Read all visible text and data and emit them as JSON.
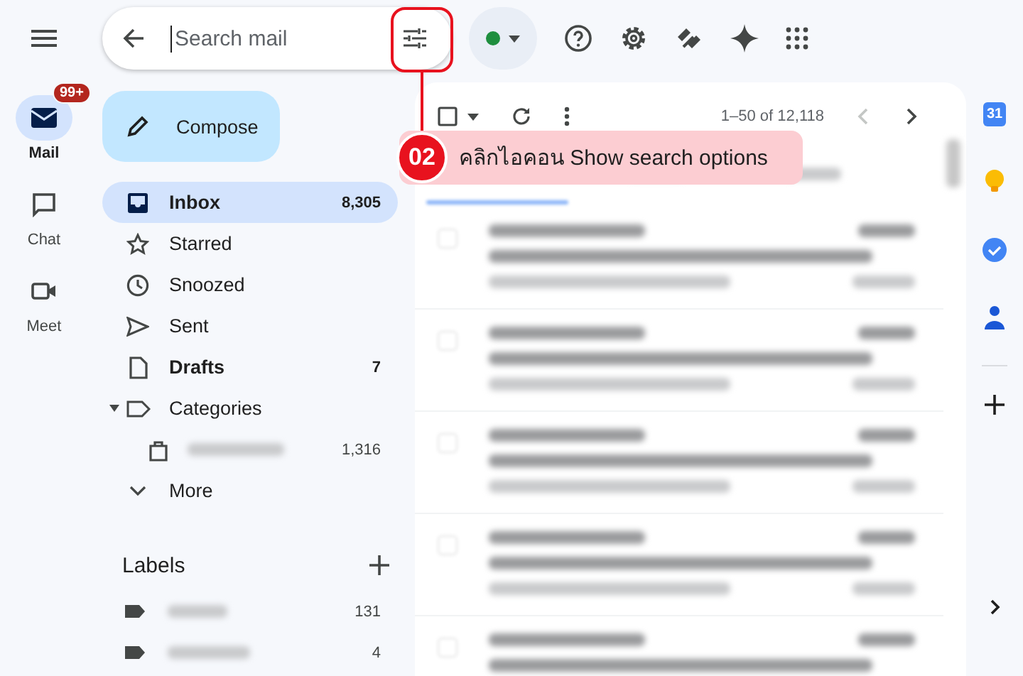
{
  "left_rail": {
    "items": [
      {
        "label": "Mail",
        "kind": "mail",
        "selected": true,
        "badge": "99+"
      },
      {
        "label": "Chat",
        "kind": "chat",
        "selected": false
      },
      {
        "label": "Meet",
        "kind": "meet",
        "selected": false
      }
    ]
  },
  "search": {
    "placeholder": "Search mail"
  },
  "compose": {
    "label": "Compose"
  },
  "nav": [
    {
      "label": "Inbox",
      "kind": "inbox",
      "count": "8,305",
      "selected": true,
      "unread": true
    },
    {
      "label": "Starred",
      "kind": "star",
      "selected": false,
      "unread": false
    },
    {
      "label": "Snoozed",
      "kind": "clock",
      "selected": false,
      "unread": false
    },
    {
      "label": "Sent",
      "kind": "sent",
      "selected": false,
      "unread": false
    },
    {
      "label": "Drafts",
      "kind": "draft",
      "count": "7",
      "selected": false,
      "unread": true
    },
    {
      "label": "Categories",
      "kind": "label",
      "selected": false,
      "unread": false,
      "expanded": true,
      "children": [
        {
          "kind": "bag",
          "count": "1,316",
          "selected": false,
          "unread": false
        }
      ]
    },
    {
      "label": "More",
      "kind": "more",
      "selected": false,
      "unread": false
    }
  ],
  "labels": {
    "title": "Labels",
    "items": [
      {
        "count": "131"
      },
      {
        "count": "4"
      }
    ]
  },
  "toolbar": {
    "select_all_checked": false,
    "range": "1–50 of 12,118",
    "prev_disabled": true,
    "next_disabled": false
  },
  "annotation": {
    "number": "02",
    "text": "คลิกไอคอน Show search options"
  },
  "right_rail": {
    "calendar_day": "31"
  }
}
